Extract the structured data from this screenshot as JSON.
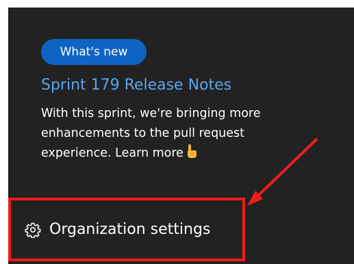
{
  "whats_new": {
    "badge_label": "What's new",
    "title": "Sprint 179 Release Notes",
    "description_lines": [
      "With this sprint, we're bringing more",
      "enhancements to the pull request",
      "experience."
    ],
    "learn_more_label": "Learn more",
    "learn_more_icon": "hand-pointing-emoji"
  },
  "footer": {
    "settings_label": "Organization settings",
    "settings_icon": "gear-icon"
  },
  "annotations": {
    "highlight_color": "#ef1c1c"
  },
  "colors": {
    "panel_background": "#222222",
    "badge_background": "#0f63c2",
    "link_color": "#58a6f1"
  }
}
